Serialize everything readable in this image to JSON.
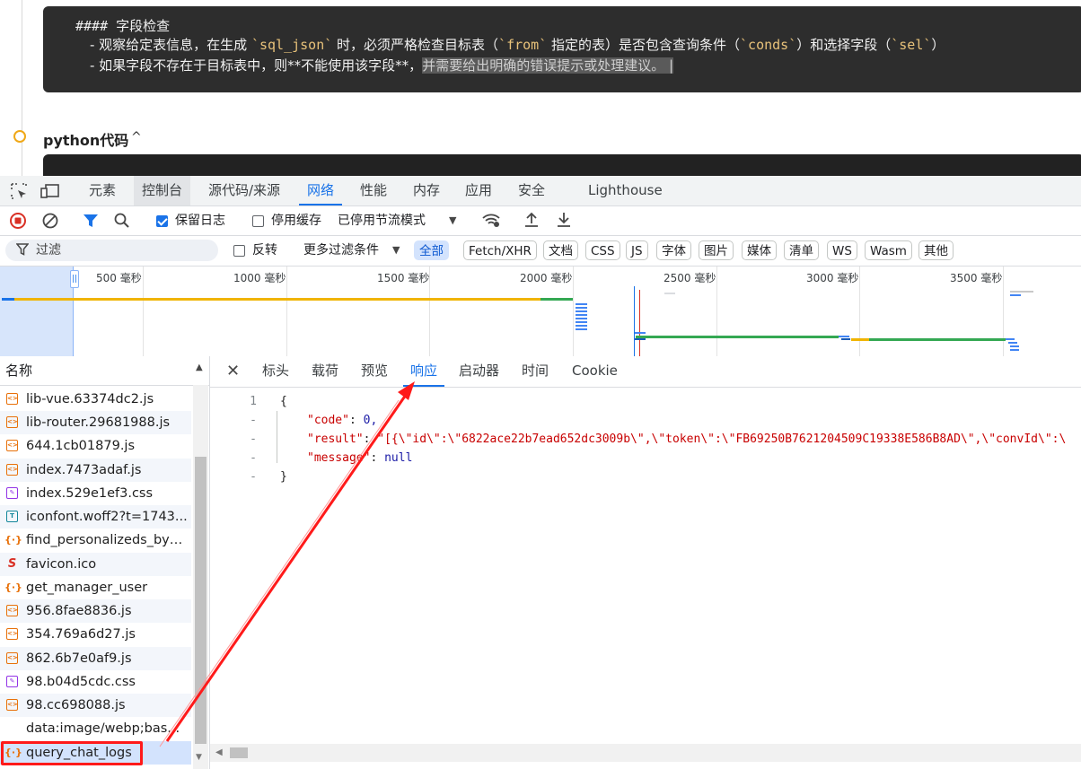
{
  "page": {
    "heading": "#### 字段检查",
    "line1_pre": "- 观察给定表信息，在生成 ",
    "line1_code1": "`sql_json`",
    "line1_mid1": " 时，必须严格检查目标表（",
    "line1_code2": "`from`",
    "line1_mid2": " 指定的表）是否包含查询条件（",
    "line1_code3": "`conds`",
    "line1_mid3": "）和选择字段（",
    "line1_code4": "`sel`",
    "line1_end": "）",
    "line2_pre": "- 如果字段不存在于目标表中，则**不能使用该字段**，",
    "line2_selected": "并需要给出明确的错误提示或处理建议。 |",
    "python_title": "python代码",
    "python_chevron": "^"
  },
  "devtools": {
    "tabs": [
      {
        "label": "元素"
      },
      {
        "label": "控制台"
      },
      {
        "label": "源代码/来源"
      },
      {
        "label": "网络"
      },
      {
        "label": "性能"
      },
      {
        "label": "内存"
      },
      {
        "label": "应用"
      },
      {
        "label": "安全"
      },
      {
        "label": "Lighthouse"
      }
    ],
    "toolbar": {
      "preserve_log": "保留日志",
      "disable_cache": "停用缓存",
      "throttling": "已停用节流模式"
    },
    "filter_bar": {
      "placeholder": "过滤",
      "invert": "反转",
      "more_filters": "更多过滤条件",
      "chips": [
        "全部",
        "Fetch/XHR",
        "文档",
        "CSS",
        "JS",
        "字体",
        "图片",
        "媒体",
        "清单",
        "WS",
        "Wasm",
        "其他"
      ]
    },
    "overview": {
      "ticks": [
        "500 毫秒",
        "1000 毫秒",
        "1500 毫秒",
        "2000 毫秒",
        "2500 毫秒",
        "3000 毫秒",
        "3500 毫秒"
      ]
    },
    "name_column": {
      "header": "名称",
      "rows": [
        {
          "name": "lib-vue.63374dc2.js",
          "type": "js"
        },
        {
          "name": "lib-router.29681988.js",
          "type": "js"
        },
        {
          "name": "644.1cb01879.js",
          "type": "js"
        },
        {
          "name": "index.7473adaf.js",
          "type": "js"
        },
        {
          "name": "index.529e1ef3.css",
          "type": "css"
        },
        {
          "name": "iconfont.woff2?t=1743...",
          "type": "font"
        },
        {
          "name": "find_personalizeds_by_...",
          "type": "xhr"
        },
        {
          "name": "favicon.ico",
          "type": "fav"
        },
        {
          "name": "get_manager_user",
          "type": "xhr"
        },
        {
          "name": "956.8fae8836.js",
          "type": "js"
        },
        {
          "name": "354.769a6d27.js",
          "type": "js"
        },
        {
          "name": "862.6b7e0af9.js",
          "type": "js"
        },
        {
          "name": "98.b04d5cdc.css",
          "type": "css"
        },
        {
          "name": "98.cc698088.js",
          "type": "js"
        },
        {
          "name": "data:image/webp;bas...",
          "type": "none"
        },
        {
          "name": "query_chat_logs",
          "type": "xhr"
        }
      ]
    },
    "detail_tabs": [
      {
        "label": "标头"
      },
      {
        "label": "载荷"
      },
      {
        "label": "预览"
      },
      {
        "label": "响应"
      },
      {
        "label": "启动器"
      },
      {
        "label": "时间"
      },
      {
        "label": "Cookie"
      }
    ],
    "response": {
      "line_numbers": [
        "1",
        "-",
        "-",
        "-",
        "-"
      ],
      "open_brace": "{",
      "code_key": "\"code\"",
      "code_value": "0,",
      "result_key": "\"result\"",
      "result_value": "\"[{\\\"id\\\":\\\"6822ace22b7ead652dc3009b\\\",\\\"token\\\":\\\"FB69250B7621204509C19338E586B8AD\\\",\\\"convId\\\":\\",
      "message_key": "\"message\"",
      "message_value": "null",
      "close_brace": "}"
    },
    "colors": {
      "accent": "#1a73e8",
      "annotation_red": "#ff1a1a"
    }
  }
}
